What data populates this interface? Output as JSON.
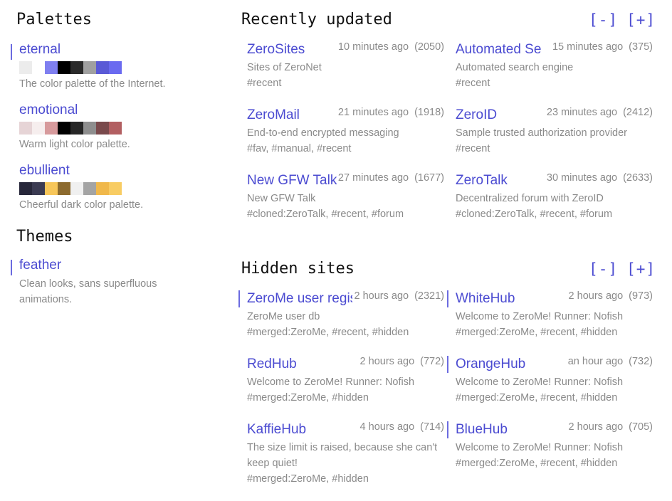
{
  "palettes": {
    "title": "Palettes",
    "items": [
      {
        "name": "eternal",
        "desc": "The color palette of the Internet.",
        "colors": [
          "#ececec",
          "#ffffff",
          "#7f7ff0",
          "#000000",
          "#2a2a2a",
          "#a0a0a0",
          "#5a5ad6",
          "#6a6af0"
        ]
      },
      {
        "name": "emotional",
        "desc": "Warm light color palette.",
        "colors": [
          "#e6d4d6",
          "#f6eeee",
          "#d79a9c",
          "#000000",
          "#262626",
          "#8e8e8e",
          "#7a4a4c",
          "#b25f61"
        ]
      },
      {
        "name": "ebullient",
        "desc": "Cheerful dark color palette.",
        "colors": [
          "#27273a",
          "#3b3b52",
          "#f7c659",
          "#8c6a2e",
          "#f0f0f0",
          "#a4a4a4",
          "#f0b84b",
          "#f8cc63"
        ]
      }
    ]
  },
  "themes": {
    "title": "Themes",
    "items": [
      {
        "name": "feather",
        "desc": "Clean looks, sans superfluous animations."
      }
    ]
  },
  "recent": {
    "title": "Recently updated",
    "collapse_label": "[-]",
    "expand_label": "[+]",
    "sites": [
      {
        "name": "ZeroSites",
        "time": "10 minutes ago",
        "peers": "(2050)",
        "desc": "Sites of ZeroNet",
        "tags": "#recent"
      },
      {
        "name": "Automated Se",
        "time": "15 minutes ago",
        "peers": "(375)",
        "desc": "Automated search engine",
        "tags": "#recent"
      },
      {
        "name": "ZeroMail",
        "time": "21 minutes ago",
        "peers": "(1918)",
        "desc": "End-to-end encrypted messaging",
        "tags": "#fav, #manual, #recent"
      },
      {
        "name": "ZeroID",
        "time": "23 minutes ago",
        "peers": "(2412)",
        "desc": "Sample trusted authorization provider",
        "tags": "#recent"
      },
      {
        "name": "New GFW Talk",
        "time": "27 minutes ago",
        "peers": "(1677)",
        "desc": "New GFW Talk",
        "tags": "#cloned:ZeroTalk, #recent, #forum"
      },
      {
        "name": "ZeroTalk",
        "time": "30 minutes ago",
        "peers": "(2633)",
        "desc": "Decentralized forum with ZeroID",
        "tags": "#cloned:ZeroTalk, #recent, #forum"
      }
    ]
  },
  "hidden": {
    "title": "Hidden sites",
    "collapse_label": "[-]",
    "expand_label": "[+]",
    "sites": [
      {
        "name": "ZeroMe user regis",
        "time": "2 hours ago",
        "peers": "(2321)",
        "desc": "ZeroMe user db",
        "tags": "#merged:ZeroMe, #recent, #hidden",
        "active": true
      },
      {
        "name": "WhiteHub",
        "time": "2 hours ago",
        "peers": "(973)",
        "desc": "Welcome to ZeroMe! Runner: Nofish",
        "tags": "#merged:ZeroMe, #recent, #hidden",
        "active": true
      },
      {
        "name": "RedHub",
        "time": "2 hours ago",
        "peers": "(772)",
        "desc": "Welcome to ZeroMe! Runner: Nofish",
        "tags": "#merged:ZeroMe, #hidden",
        "active": false
      },
      {
        "name": "OrangeHub",
        "time": "an hour ago",
        "peers": "(732)",
        "desc": "Welcome to ZeroMe! Runner: Nofish",
        "tags": "#merged:ZeroMe, #recent, #hidden",
        "active": true
      },
      {
        "name": "KaffieHub",
        "time": "4 hours ago",
        "peers": "(714)",
        "desc": "The size limit is raised, because she can't keep quiet!",
        "tags": "#merged:ZeroMe, #hidden",
        "active": false
      },
      {
        "name": "BlueHub",
        "time": "2 hours ago",
        "peers": "(705)",
        "desc": "Welcome to ZeroMe! Runner: Nofish",
        "tags": "#merged:ZeroMe, #recent, #hidden",
        "active": true
      }
    ]
  }
}
